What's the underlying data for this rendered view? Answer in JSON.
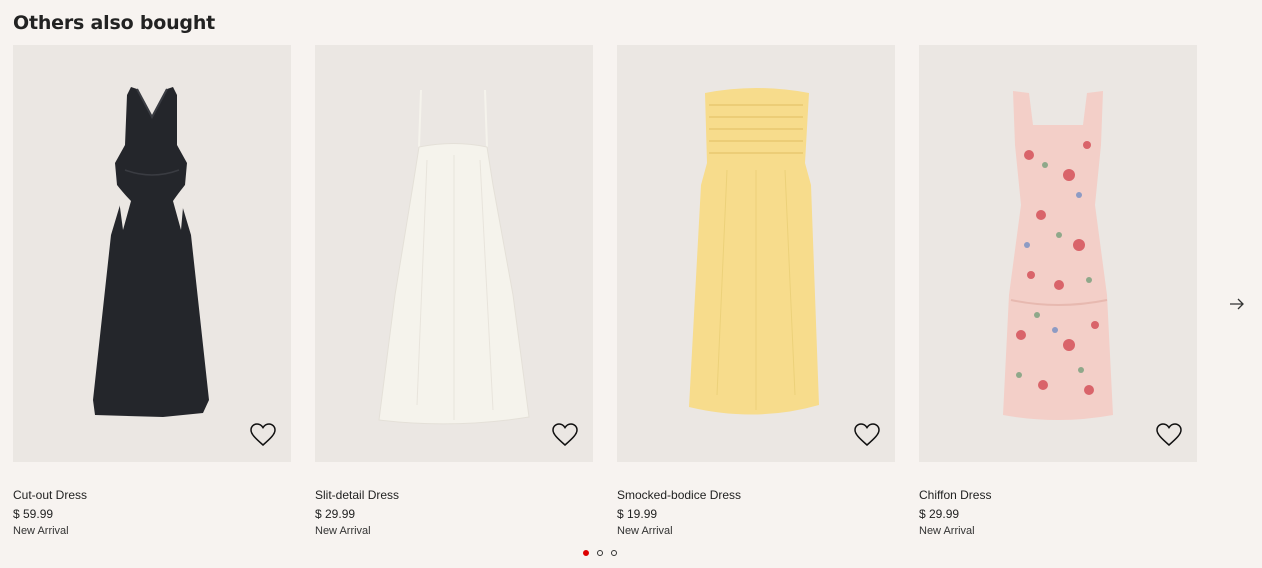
{
  "section": {
    "title": "Others also bought"
  },
  "products": [
    {
      "name": "Cut-out Dress",
      "price": "$ 59.99",
      "badge": "New Arrival",
      "color": "#24262b",
      "icon": "heart-outline-icon"
    },
    {
      "name": "Slit-detail Dress",
      "price": "$ 29.99",
      "badge": "New Arrival",
      "color": "#f5f3ec",
      "icon": "heart-outline-icon"
    },
    {
      "name": "Smocked-bodice Dress",
      "price": "$ 19.99",
      "badge": "New Arrival",
      "color": "#f7dc8c",
      "icon": "heart-outline-icon"
    },
    {
      "name": "Chiffon Dress",
      "price": "$ 29.99",
      "badge": "New Arrival",
      "color": "#f3cfc8",
      "icon": "heart-outline-icon"
    }
  ],
  "carousel": {
    "pages": 3,
    "active_page": 1,
    "next_icon": "arrow-right-icon",
    "active_dot_color": "#dd0000"
  }
}
